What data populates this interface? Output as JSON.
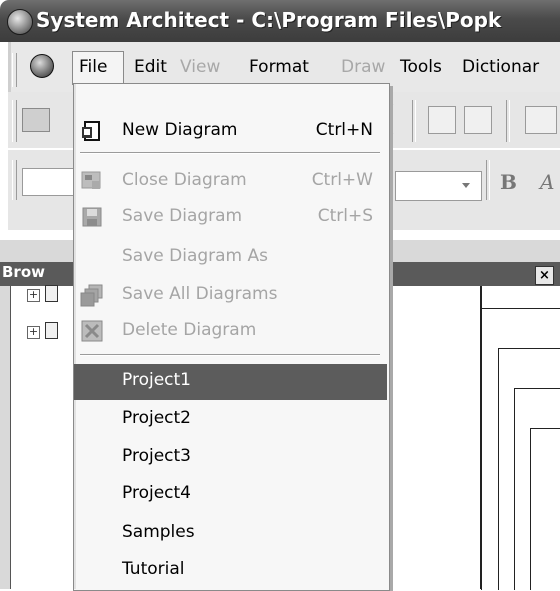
{
  "window": {
    "title": "System Architect - C:\\Program Files\\Popk"
  },
  "menubar": {
    "items": [
      {
        "label": "File",
        "enabled": true
      },
      {
        "label": "Edit",
        "enabled": true
      },
      {
        "label": "View",
        "enabled": false
      },
      {
        "label": "Format",
        "enabled": true
      },
      {
        "label": "Draw",
        "enabled": false
      },
      {
        "label": "Tools",
        "enabled": true
      },
      {
        "label": "Dictionar",
        "enabled": true
      }
    ]
  },
  "browser": {
    "title": "Brow",
    "close_label": "×"
  },
  "file_menu": {
    "items": [
      {
        "label": "New Diagram",
        "shortcut": "Ctrl+N",
        "enabled": true,
        "icon": "new-diagram-icon"
      },
      {
        "label": "Close Diagram",
        "shortcut": "Ctrl+W",
        "enabled": false,
        "icon": "close-diagram-icon"
      },
      {
        "label": "Save Diagram",
        "shortcut": "Ctrl+S",
        "enabled": false,
        "icon": "save-diagram-icon"
      },
      {
        "label": "Save Diagram As",
        "shortcut": "",
        "enabled": false,
        "icon": ""
      },
      {
        "label": "Save All Diagrams",
        "shortcut": "",
        "enabled": false,
        "icon": "save-all-diagrams-icon"
      },
      {
        "label": "Delete Diagram",
        "shortcut": "",
        "enabled": false,
        "icon": "delete-diagram-icon"
      }
    ],
    "projects": [
      {
        "label": "Project1",
        "selected": true
      },
      {
        "label": "Project2",
        "selected": false
      },
      {
        "label": "Project3",
        "selected": false
      },
      {
        "label": "Project4",
        "selected": false
      },
      {
        "label": "Samples",
        "selected": false
      },
      {
        "label": "Tutorial",
        "selected": false
      }
    ]
  },
  "toolbar": {
    "bold_label": "B",
    "italic_label": "A"
  }
}
